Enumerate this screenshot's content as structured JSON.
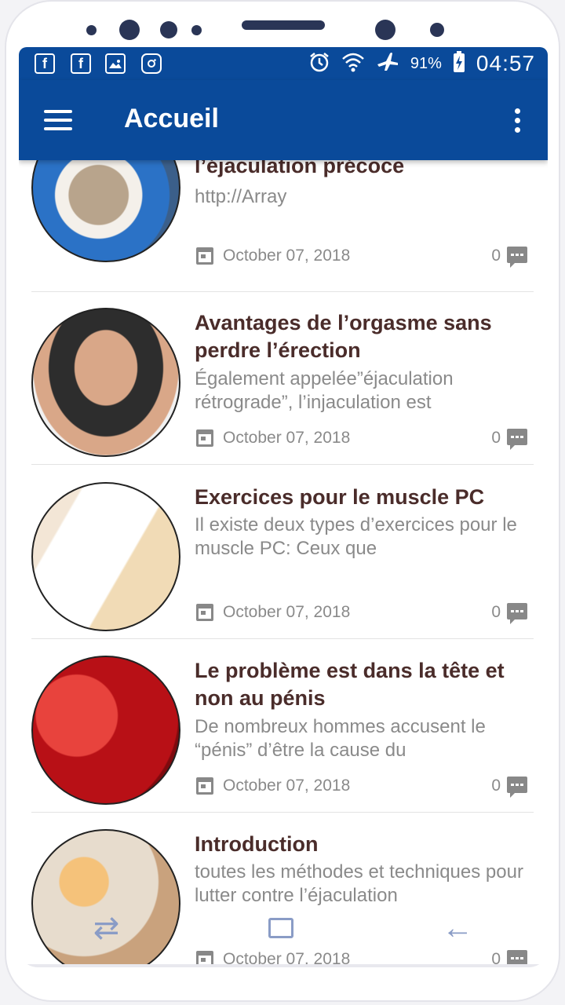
{
  "statusbar": {
    "left_icons": [
      "facebook-icon",
      "facebook-icon",
      "image-icon",
      "instagram-icon"
    ],
    "battery": "91%",
    "time": "04:57"
  },
  "appbar": {
    "title": "Accueil"
  },
  "articles": [
    {
      "title": "l’éjaculation précoce",
      "excerpt": "http://Array",
      "date": "October 07, 2018",
      "comments": "0",
      "thumb": "powder-glass"
    },
    {
      "title": "Avantages de l’orgasme sans perdre l’érection",
      "excerpt": "Également appelée”éjaculation rétrograde”, l’injaculation est",
      "date": "October 07, 2018",
      "comments": "0",
      "thumb": "man-towel"
    },
    {
      "title": "Exercices pour le muscle PC",
      "excerpt": "Il existe deux types d’exercices pour le muscle PC: Ceux que",
      "date": "October 07, 2018",
      "comments": "0",
      "thumb": "anatomy"
    },
    {
      "title": "Le problème est dans la tête et non au pénis",
      "excerpt": "De nombreux hommes accusent le “pénis” d’être la cause du",
      "date": "October 07, 2018",
      "comments": "0",
      "thumb": "champagne"
    },
    {
      "title": "Introduction",
      "excerpt": "toutes les méthodes et techniques pour lutter contre l’éjaculation",
      "date": "October 07, 2018",
      "comments": "0",
      "thumb": "matches"
    }
  ],
  "colors": {
    "primary": "#0a4a9a",
    "title_text": "#4a2c2a",
    "muted_text": "#8a8a8a"
  }
}
